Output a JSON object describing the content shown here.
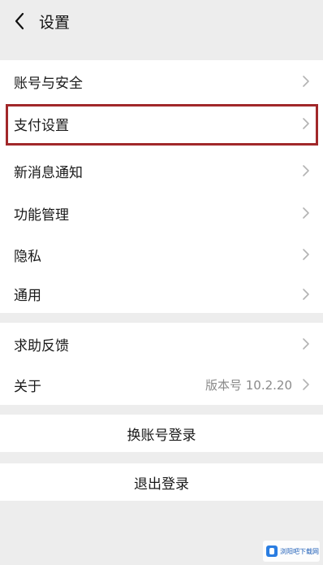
{
  "header": {
    "back_icon": "chevron-left-icon",
    "title": "设置"
  },
  "group1": {
    "items": [
      {
        "label": "账号与安全"
      },
      {
        "label": "支付设置"
      },
      {
        "label": "新消息通知"
      },
      {
        "label": "功能管理"
      },
      {
        "label": "隐私"
      },
      {
        "label": "通用"
      }
    ]
  },
  "group2": {
    "items": [
      {
        "label": "求助反馈"
      },
      {
        "label": "关于",
        "value": "版本号 10.2.20"
      }
    ]
  },
  "actions": {
    "switch_account": "换账号登录",
    "logout": "退出登录"
  },
  "watermark": {
    "text": "浏阳吧下载网"
  },
  "colors": {
    "background": "#ededed",
    "card": "#ffffff",
    "highlight_border": "#a1282a",
    "chevron": "#b3b3b3",
    "secondary_text": "#8a8a8a"
  }
}
